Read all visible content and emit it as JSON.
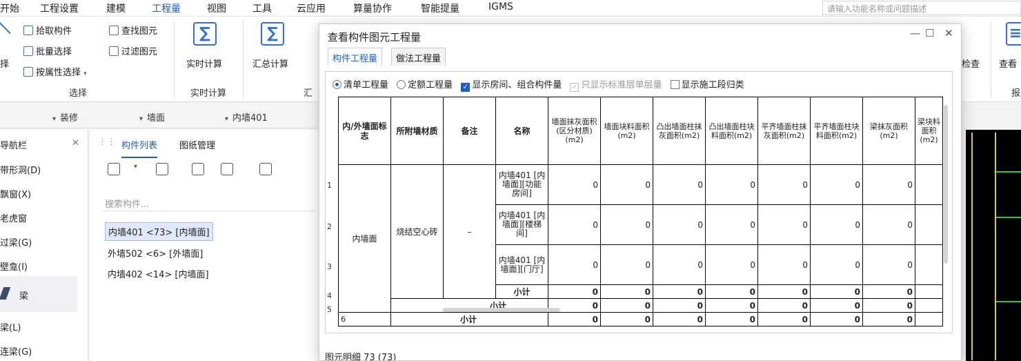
{
  "menu": {
    "items": [
      "开始",
      "工程设置",
      "建模",
      "工程量",
      "视图",
      "工具",
      "云应用",
      "算量协作",
      "智能提量",
      "IGMS"
    ],
    "active": "工程量",
    "search_placeholder": "请输入功能名称或问题描述"
  },
  "ribbon": {
    "pick": "拾取构件",
    "batch": "批量选择",
    "by_attr": "按属性选择",
    "find": "查找图元",
    "filter": "过滤图元",
    "select_group": "选择",
    "realtime": "实时计算",
    "realtime_group": "实时计算",
    "summary": "汇总计算",
    "summary_group": "汇",
    "left_clip": "择",
    "check": "检查",
    "view": "查看",
    "report_clip": "报"
  },
  "filterbar": {
    "f1": "装修",
    "f2": "墙面",
    "f3": "内墙401"
  },
  "nav": {
    "title": "导航栏",
    "items": [
      "带形洞(D)",
      "飘窗(X)",
      "老虎窗",
      "过梁(G)",
      "壁龛(I)",
      "梁",
      "梁(L)",
      "连梁(G)"
    ]
  },
  "component_list": {
    "tabs": [
      "构件列表",
      "图纸管理"
    ],
    "search_placeholder": "搜索构件...",
    "items": [
      "内墙401 <73> [内墙面]",
      "外墙502 <6> [外墙面]",
      "内墙402 <14> [内墙面]"
    ]
  },
  "dialog": {
    "title": "查看构件图元工程量",
    "tabs": [
      "构件工程量",
      "做法工程量"
    ],
    "options": {
      "list_qty": "清单工程量",
      "quota_qty": "定额工程量",
      "show_rooms": "显示房间、组合构件量",
      "std_floor": "只显示标准层单层量",
      "show_stage": "显示施工段归类"
    },
    "columns": [
      "内/外墙面标志",
      "所附墙材质",
      "备注",
      "名称",
      "墙面抹灰面积(区分材质)(m2)",
      "墙面块料面积(m2)",
      "凸出墙面柱抹灰面积(m2)",
      "凸出墙面柱块料面积(m2)",
      "平齐墙面柱抹灰面积(m2)",
      "平齐墙面柱块料面积(m2)",
      "梁抹灰面积(m2)",
      "梁块料面积(m2)"
    ],
    "col_partial": "梁块料\n积(m",
    "wall_flag": "内墙面",
    "material": "烧结空心砖",
    "remark": "–",
    "rows": [
      {
        "n": "1",
        "name": "内墙401 [内墙面][功能房间]",
        "vals": [
          "0",
          "0",
          "0",
          "0",
          "0",
          "0",
          "0"
        ]
      },
      {
        "n": "2",
        "name": "内墙401 [内墙面][楼梯间]",
        "vals": [
          "0",
          "0",
          "0",
          "0",
          "0",
          "0",
          "0"
        ]
      },
      {
        "n": "3",
        "name": "内墙401 [内墙面][门厅]",
        "vals": [
          "0",
          "0",
          "0",
          "0",
          "0",
          "0",
          "0"
        ]
      },
      {
        "n": "4",
        "name": "小计",
        "vals": [
          "0",
          "0",
          "0",
          "0",
          "0",
          "0",
          "0"
        ]
      },
      {
        "n": "5",
        "name": "小计",
        "vals": [
          "0",
          "0",
          "0",
          "0",
          "0",
          "0",
          "0"
        ]
      },
      {
        "n": "6",
        "name": "小计",
        "vals": [
          "0",
          "0",
          "0",
          "0",
          "0",
          "0",
          "0"
        ]
      }
    ],
    "detail": "图元明细 73 (73)"
  }
}
